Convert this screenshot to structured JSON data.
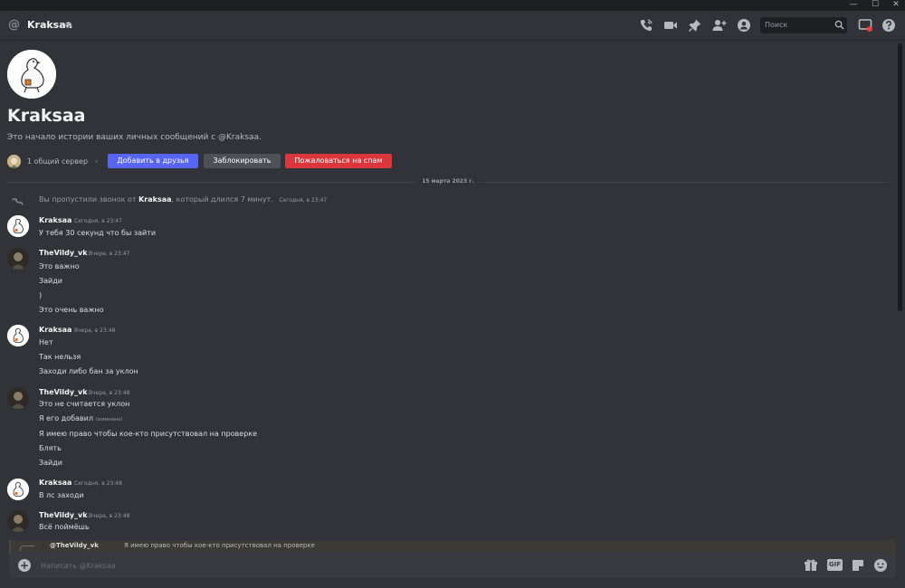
{
  "window": {
    "minimize": "—",
    "maximize": "☐",
    "close": "✕"
  },
  "header": {
    "at": "@",
    "name": "Kraksaa",
    "search_placeholder": "Поиск"
  },
  "icons": {
    "call": "phone-call-icon",
    "video": "video-icon",
    "pin": "pin-icon",
    "add_member": "add-member-icon",
    "profile": "user-profile-icon",
    "inbox": "inbox-icon",
    "help": "help-icon"
  },
  "colors": {
    "background": "#313338",
    "primary": "#5865f2",
    "danger": "#da373c",
    "secondary": "#4e5058",
    "notification": "#f23f43"
  },
  "profile": {
    "name": "Kraksaa",
    "description": "Это начало истории ваших личных сообщений с @Kraksaa.",
    "mutual_servers": "1 общий сервер",
    "add_friend": "Добавить в друзья",
    "block": "Заблокировать",
    "report_spam": "Пожаловаться на спам"
  },
  "date_divider": "15 марта 2023 г.",
  "missed_call": {
    "prefix": "Вы пропустили звонок от",
    "caller": "Kraksaa",
    "suffix": ", который длился 7 минут.",
    "timestamp": "Сегодня, в 23:47"
  },
  "messages": [
    {
      "author": "Kraksaa",
      "timestamp": "Сегодня, в 23:47",
      "lines": [
        "У тебя 30 секунд что бы зайти"
      ]
    },
    {
      "author": "TheVildy_vk",
      "timestamp": "Вчера, в 23:47",
      "lines": [
        "Это важно",
        "Зайди",
        ")",
        "Это очень важно"
      ]
    },
    {
      "author": "Kraksaa",
      "timestamp": "Вчера, в 23:48",
      "lines": [
        "Нет",
        "Так нельзя",
        "Заходи либо бан за уклон"
      ]
    },
    {
      "author": "TheVildy_vk",
      "timestamp": "Вчера, в 23:48",
      "lines": [
        "Это не считается уклон",
        "Я его добавил",
        "Я имею право чтобы кое-кто присутствовал на проверке",
        "Блять",
        "Зайди"
      ],
      "edited_label": "(изменено)"
    },
    {
      "author": "Kraksaa",
      "timestamp": "Сегодня, в 23:48",
      "lines": [
        "В лс заходи"
      ]
    },
    {
      "author": "TheVildy_vk",
      "timestamp": "Вчера, в 23:48",
      "lines": [
        "Всё поймёшь"
      ]
    }
  ],
  "reply": {
    "author": "@TheVildy_vk",
    "text": "Я имею право чтобы кое-кто присутствовал на проверке"
  },
  "composer": {
    "placeholder": "Написать @Kraksaa",
    "plus": "+",
    "gif": "GIF",
    "gift_icon": "gift-icon",
    "sticker_icon": "sticker-icon",
    "emoji_icon": "emoji-icon"
  }
}
